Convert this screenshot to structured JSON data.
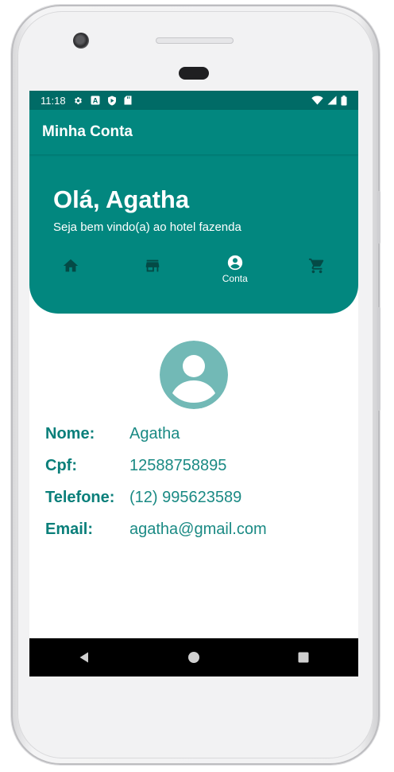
{
  "status_bar": {
    "time": "11:18",
    "left_icons": [
      "settings-icon",
      "a-notification-icon",
      "shield-icon",
      "sd-card-icon"
    ],
    "right_icons": [
      "wifi-icon",
      "signal-icon",
      "battery-icon"
    ]
  },
  "app_bar": {
    "title": "Minha Conta"
  },
  "header": {
    "greeting": "Olá, Agatha",
    "subtitle": "Seja bem vindo(a) ao hotel fazenda"
  },
  "nav": {
    "items": [
      {
        "icon": "home-icon",
        "label": "",
        "active": false
      },
      {
        "icon": "store-icon",
        "label": "",
        "active": false
      },
      {
        "icon": "account-circle-icon",
        "label": "Conta",
        "active": true
      },
      {
        "icon": "cart-icon",
        "label": "",
        "active": false
      }
    ]
  },
  "profile": {
    "fields": [
      {
        "label": "Nome:",
        "value": "Agatha"
      },
      {
        "label": "Cpf:",
        "value": "12588758895"
      },
      {
        "label": "Telefone:",
        "value": "(12) 995623589"
      },
      {
        "label": "Email:",
        "value": "agatha@gmail.com"
      }
    ]
  },
  "system_nav": [
    "back-icon",
    "home-circle-icon",
    "recents-icon"
  ],
  "colors": {
    "primary": "#02877f",
    "status_bar": "#006b66",
    "text_accent": "#0a7f7a",
    "avatar_bg": "#72b9b6"
  }
}
